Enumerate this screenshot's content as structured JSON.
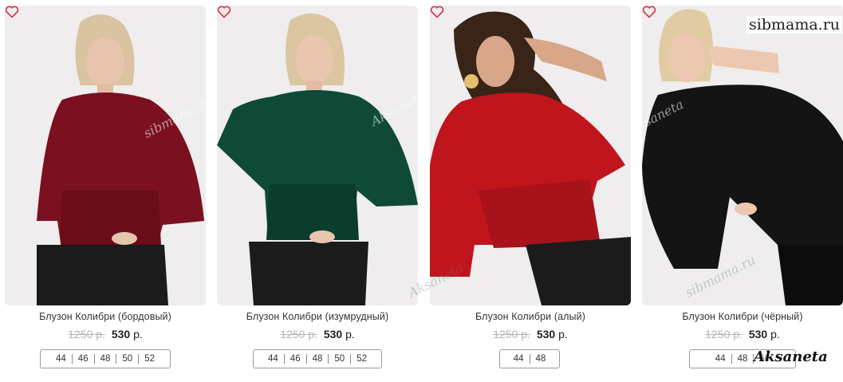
{
  "colors": {
    "burgundy": "#7a1020",
    "emerald": "#0e4a36",
    "scarlet": "#c0151c",
    "black": "#141414",
    "heart": "#d3324a"
  },
  "watermarks": {
    "site": "sibmama.ru",
    "author": "Aksaneta"
  },
  "products": [
    {
      "title": "Блузон Колибри (бордовый)",
      "old_price": "1250 р.",
      "price": "530",
      "currency": "р.",
      "sizes": [
        "44",
        "46",
        "48",
        "50",
        "52"
      ]
    },
    {
      "title": "Блузон Колибри (изумрудный)",
      "old_price": "1250 р.",
      "price": "530",
      "currency": "р.",
      "sizes": [
        "44",
        "46",
        "48",
        "50",
        "52"
      ]
    },
    {
      "title": "Блузон Колибри (алый)",
      "old_price": "1250 р.",
      "price": "530",
      "currency": "р.",
      "sizes": [
        "44",
        "48"
      ]
    },
    {
      "title": "Блузон Колибри (чёрный)",
      "old_price": "1250 р.",
      "price": "530",
      "currency": "р.",
      "sizes": [
        "44",
        "48",
        "50"
      ]
    }
  ]
}
